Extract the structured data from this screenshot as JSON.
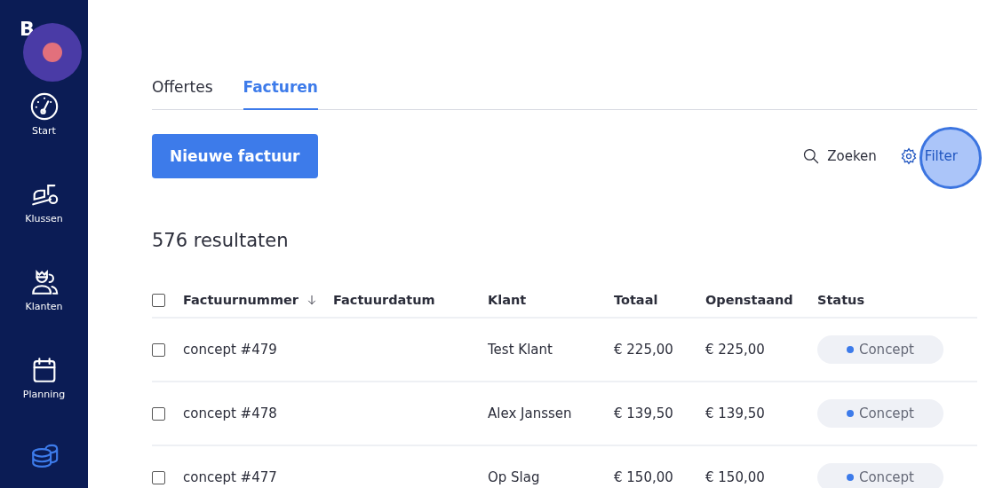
{
  "sidebar": {
    "logo": "B",
    "items": [
      {
        "kind": "start",
        "label": "Start",
        "selected": false
      },
      {
        "kind": "jobs",
        "label": "Klussen",
        "selected": false
      },
      {
        "kind": "clients",
        "label": "Klanten",
        "selected": false
      },
      {
        "kind": "planning",
        "label": "Planning",
        "selected": false
      },
      {
        "kind": "finance",
        "selected": true
      }
    ]
  },
  "tabs": [
    {
      "label": "Offertes",
      "selected": false
    },
    {
      "label": "Facturen",
      "selected": true
    }
  ],
  "new_button": "Nieuwe factuur",
  "search": "Zoeken",
  "filter": "Filter",
  "result_count": "576 resultaten",
  "table": {
    "columns": [
      {
        "label": "Factuurnummer",
        "sorted": true
      },
      {
        "label": "Factuurdatum",
        "sorted": false
      },
      {
        "label": "Klant",
        "sorted": false
      },
      {
        "label": "Totaal",
        "sorted": false
      },
      {
        "label": "Openstaand",
        "sorted": false
      },
      {
        "label": "Status",
        "sorted": false
      }
    ],
    "all_checked": false,
    "rows": [
      {
        "checked": false,
        "cells": [
          "concept #479",
          "",
          "Test Klant",
          "€ 225,00",
          "€ 225,00"
        ],
        "status": "Concept"
      },
      {
        "checked": false,
        "cells": [
          "concept #478",
          "",
          "Alex Janssen",
          "€ 139,50",
          "€ 139,50"
        ],
        "status": "Concept"
      },
      {
        "checked": false,
        "cells": [
          "concept #477",
          "",
          "Op Slag",
          "€ 150,00",
          "€ 150,00"
        ],
        "status": "Concept"
      }
    ]
  }
}
